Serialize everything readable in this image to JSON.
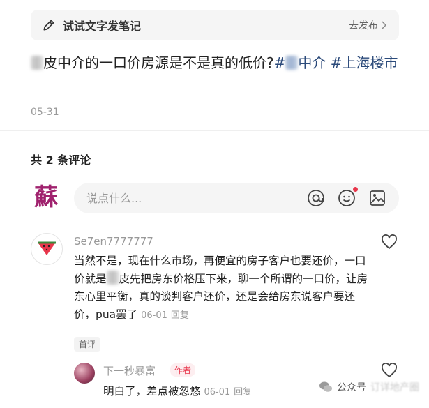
{
  "write_bar": {
    "label": "试试文字发笔记",
    "action": "去发布"
  },
  "post": {
    "text_1": "皮中介的一口价房源是不是真的低价?",
    "tag_1_suffix": "中介",
    "tag_2": "#上海楼市",
    "tag_1_prefix": "#",
    "date": "05-31"
  },
  "comments_header": "共 2 条评论",
  "comment_input": {
    "placeholder": "说点什么..."
  },
  "comments": [
    {
      "user": "Se7en7777777",
      "text_a": "当然不是，现在什么市场，再便宜的房子客户也要还价，一口价就是",
      "text_b": "皮先把房东价格压下来，聊一个所谓的一口价，让房东心里平衡，真的谈判客户还价，还是会给房东说客户要还价，pua罢了",
      "date": "06-01",
      "reply": "回复",
      "badge": "首评"
    },
    {
      "user": "下一秒暴富",
      "author_tag": "作者",
      "text": "明白了，差点被忽悠",
      "date": "06-01",
      "reply": "回复"
    }
  ],
  "watermark": {
    "label": "公众号",
    "name": "订详地产圈"
  },
  "icons": [
    "pen-icon",
    "chevron-right-icon",
    "at-icon",
    "emoji-icon",
    "image-icon",
    "heart-icon",
    "watermelon-avatar-icon",
    "wechat-icon"
  ],
  "colors": {
    "tag": "#2b4a7a",
    "accent_red": "#e8364b",
    "logo": "#a0226e"
  }
}
